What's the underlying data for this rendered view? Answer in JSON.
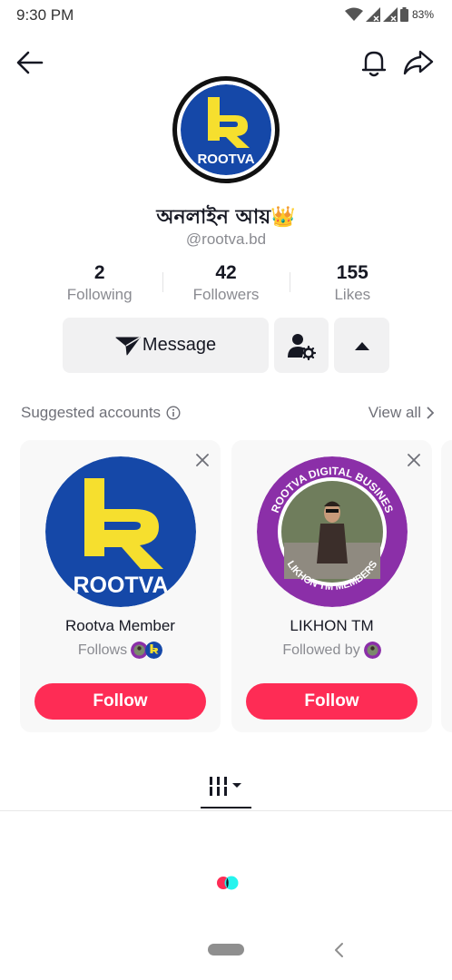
{
  "status_bar": {
    "time": "9:30 PM",
    "battery": "83%",
    "icons": [
      "wifi-icon",
      "signal-icon",
      "signal-icon",
      "battery-icon"
    ]
  },
  "nav": {
    "back_icon": "arrow-left-icon",
    "bell_icon": "bell-icon",
    "share_icon": "share-arrow-icon"
  },
  "profile": {
    "name": "অনলাইন আয়👑",
    "handle": "@rootva.bd",
    "avatar_text": "ROOTVA",
    "stats": [
      {
        "value": "2",
        "label": "Following"
      },
      {
        "value": "42",
        "label": "Followers"
      },
      {
        "value": "155",
        "label": "Likes"
      }
    ]
  },
  "actions": {
    "message_label": "Message",
    "message_icon": "paper-plane-icon",
    "friend_icon": "user-settings-icon",
    "more_icon": "caret-up-icon"
  },
  "suggested": {
    "title": "Suggested accounts",
    "view_all": "View all",
    "cards": [
      {
        "name": "Rootva Member",
        "subtitle": "Follows",
        "follow_label": "Follow",
        "avatar_text": "ROOTVA"
      },
      {
        "name": "LIKHON TM",
        "subtitle": "Followed by",
        "follow_label": "Follow",
        "avatar_ring_top": "ROOTVA DIGITAL BUSINES",
        "avatar_ring_bottom": "LIKHON TM MEMBERS"
      }
    ]
  },
  "tabs": {
    "active_icon": "video-grid-icon"
  },
  "colors": {
    "accent": "#fe2c55",
    "brand_blue": "#1548a8",
    "brand_yellow": "#f6df2e",
    "ring_purple": "#8b2fa8"
  }
}
